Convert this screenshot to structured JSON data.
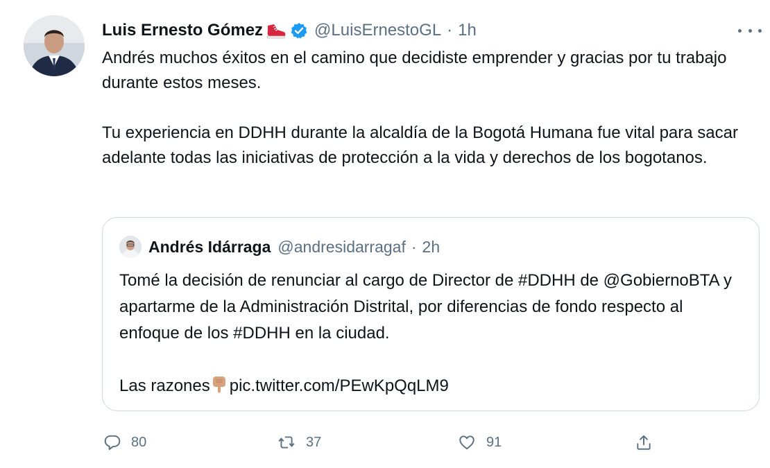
{
  "author": {
    "name": "Luis Ernesto Gómez",
    "handle": "@LuisErnestoGL",
    "separator": "·",
    "time": "1h"
  },
  "tweet": {
    "paragraphs": [
      "Andrés muchos éxitos en el camino que decidiste emprender y gracias por tu trabajo durante estos meses.",
      "Tu experiencia en DDHH durante la alcaldía de la Bogotá Humana fue vital para sacar adelante todas las iniciativas de protección a la vida y derechos de los bogotanos."
    ]
  },
  "quoted": {
    "name": "Andrés Idárraga",
    "handle": "@andresidarragaf",
    "separator": "·",
    "time": "2h",
    "paragraph1": "Tomé la decisión de renunciar al cargo de Director de #DDHH de @GobiernoBTA y apartarme de la Administración Distrital, por diferencias de fondo respecto al enfoque de los #DDHH en la ciudad.",
    "reasons_label": "Las razones",
    "link": "pic.twitter.com/PEwKpQqLM9"
  },
  "actions": {
    "replies": "80",
    "retweets": "37",
    "likes": "91"
  },
  "icons": {
    "more": "more-options-icon",
    "verified": "verified-badge-icon",
    "shoe": "shoe-emoji-icon",
    "pointing": "backhand-index-pointing-down-emoji-icon",
    "reply": "reply-icon",
    "retweet": "retweet-icon",
    "like": "like-icon",
    "share": "share-icon"
  },
  "colors": {
    "text": "#0f1419",
    "secondary": "#5b7083",
    "verified": "#1d9bf0",
    "border": "#cfd9de"
  }
}
